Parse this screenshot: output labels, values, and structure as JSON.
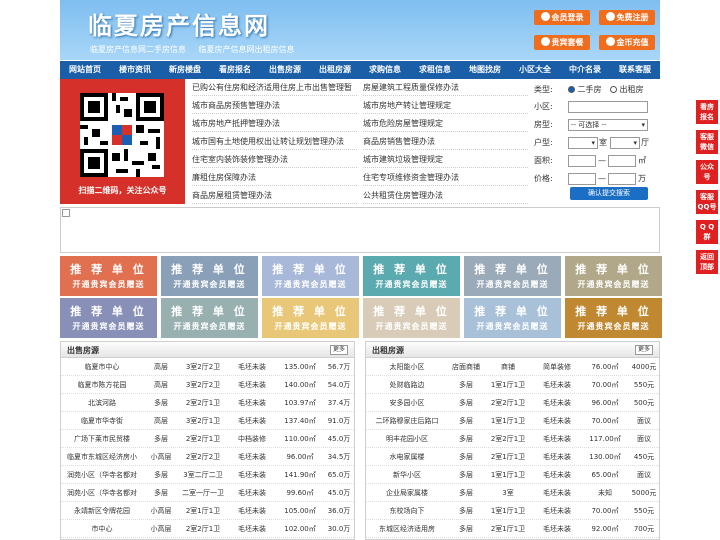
{
  "header": {
    "title": "临夏房产信息网",
    "subtitles": [
      "临夏房产信息网二手房信息",
      "临夏房产信息网出租房信息"
    ],
    "buttons": [
      {
        "label": "会员登录"
      },
      {
        "label": "免费注册"
      },
      {
        "label": "贵宾套餐"
      },
      {
        "label": "金币充值"
      }
    ]
  },
  "nav": [
    "网站首页",
    "楼市资讯",
    "新房楼盘",
    "看房报名",
    "出售房源",
    "出租房源",
    "求购信息",
    "求租信息",
    "地图找房",
    "小区大全",
    "中介名录",
    "联系客服"
  ],
  "qr": {
    "caption": "扫描二维码，关注公众号"
  },
  "links": {
    "wide": "已购公有住房和经济适用住房上市出售管理暂",
    "left": [
      "城市商品房预售管理办法",
      "城市房地产抵押管理办法",
      "城市国有土地使用权出让转让规划管理办法",
      "住宅室内装饰装修管理办法",
      "廉租住房保障办法",
      "商品房屋租赁管理办法"
    ],
    "right": [
      "房屋建筑工程质量保修办法",
      "城市房地产转让管理规定",
      "城市危险房屋管理规定",
      "商品房销售管理办法",
      "城市建筑垃圾管理规定",
      "住宅专项维修资金管理办法",
      "公共租赁住房管理办法"
    ]
  },
  "search": {
    "type_label": "类型:",
    "type_options": [
      "二手房",
      "出租房"
    ],
    "community_label": "小区:",
    "kind_label": "房型:",
    "kind_value": "-- 可选择 --",
    "layout_label": "户型:",
    "room_unit": "室",
    "hall_unit": "厅",
    "area_label": "面积:",
    "area_unit": "㎡",
    "price_label": "价格:",
    "price_unit": "万",
    "submit": "确认提交搜索"
  },
  "ads": {
    "title": "推 荐 单 位",
    "subtitle": "开通贵宾会员赠送",
    "colors": [
      "#e07050",
      "#8aa0b8",
      "#a8b8d8",
      "#5aaab0",
      "#9aaab8",
      "#b0a888",
      "#8890b8",
      "#98b0b0",
      "#e8c878",
      "#d8ccb8",
      "#a8c0d8",
      "#c08830"
    ]
  },
  "sale": {
    "title": "出售房源",
    "more": "更多",
    "rows": [
      [
        "临夏市中心",
        "高层",
        "3室2厅2卫",
        "毛坯未装",
        "135.00㎡",
        "56.7万"
      ],
      [
        "临夏市陈方花园",
        "高层",
        "3室2厅2卫",
        "毛坯未装",
        "140.00㎡",
        "54.0万"
      ],
      [
        "北滨河路",
        "多层",
        "2室2厅1卫",
        "毛坯未装",
        "103.97㎡",
        "37.4万"
      ],
      [
        "临夏市华寺街",
        "高层",
        "3室2厅1卫",
        "毛坯未装",
        "137.40㎡",
        "91.0万"
      ],
      [
        "广场下莱市民贸楼",
        "多层",
        "2室2厅1卫",
        "中档装修",
        "110.00㎡",
        "45.0万"
      ],
      [
        "临夏市东城区经济房小",
        "小高层",
        "2室2厅2卫",
        "毛坯未装",
        "96.00㎡",
        "34.5万"
      ],
      [
        "润苑小区（华寺名都对",
        "多层",
        "3室二厅二卫",
        "毛坯未装",
        "141.90㎡",
        "65.0万"
      ],
      [
        "润苑小区（华寺名都对",
        "多层",
        "二室一厅一卫",
        "毛坯未装",
        "99.60㎡",
        "45.0万"
      ],
      [
        "永靖新区令牌花园",
        "小高层",
        "2室1厅1卫",
        "毛坯未装",
        "105.00㎡",
        "36.0万"
      ],
      [
        "市中心",
        "小高层",
        "2室2厅1卫",
        "毛坯未装",
        "102.00㎡",
        "30.0万"
      ]
    ]
  },
  "rent": {
    "title": "出租房源",
    "more": "更多",
    "rows": [
      [
        "太阳能小区",
        "店面商铺",
        "商铺",
        "简单装修",
        "76.00㎡",
        "4000元"
      ],
      [
        "处财临路边",
        "多层",
        "1室1厅1卫",
        "毛坯未装",
        "70.00㎡",
        "550元"
      ],
      [
        "安多园小区",
        "多层",
        "2室2厅1卫",
        "毛坯未装",
        "96.00㎡",
        "500元"
      ],
      [
        "二环路穆家庄后路口",
        "多层",
        "1室1厅1卫",
        "毛坯未装",
        "70.00㎡",
        "面议"
      ],
      [
        "明丰花园小区",
        "多层",
        "2室2厅1卫",
        "毛坯未装",
        "117.00㎡",
        "面议"
      ],
      [
        "水电家属楼",
        "多层",
        "2室1厅1卫",
        "毛坯未装",
        "130.00㎡",
        "450元"
      ],
      [
        "新华小区",
        "多层",
        "1室1厅1卫",
        "毛坯未装",
        "65.00㎡",
        "面议"
      ],
      [
        "企业局家属楼",
        "多层",
        "3室",
        "毛坯未装",
        "未知",
        "5000元"
      ],
      [
        "东校场向下",
        "多层",
        "1室1厅1卫",
        "毛坯未装",
        "70.00㎡",
        "550元"
      ],
      [
        "东城区经济适用房",
        "多层",
        "2室1厅1卫",
        "毛坯未装",
        "92.00㎡",
        "700元"
      ]
    ]
  },
  "float": [
    "看房\n报名",
    "客服\n微信",
    "公众\n号",
    "客服\nQQ号",
    "Q Q\n群",
    "返回\n顶部"
  ]
}
